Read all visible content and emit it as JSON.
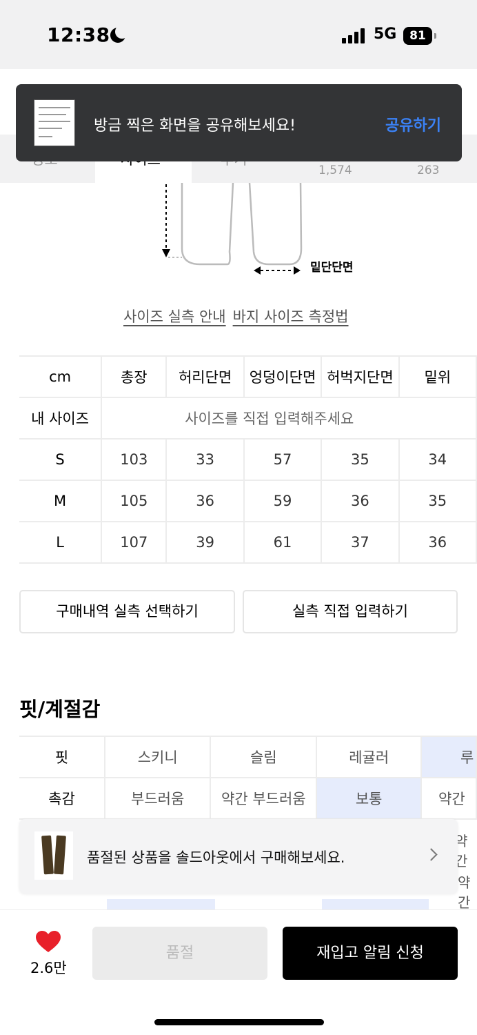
{
  "status_bar": {
    "time": "12:38",
    "network": "5G",
    "battery": "81"
  },
  "tabs": {
    "items": [
      "정보",
      "사이즈",
      "후기"
    ],
    "counts": [
      "1,574",
      "263"
    ]
  },
  "toast": {
    "message": "방금 찍은 화면을 공유해보세요!",
    "action": "공유하기"
  },
  "diagram": {
    "label": "밑단단면"
  },
  "size_links": [
    "사이즈 실측 안내",
    "바지 사이즈 측정법"
  ],
  "size_table": {
    "headers": [
      "cm",
      "총장",
      "허리단면",
      "엉덩이단면",
      "허벅지단면",
      "밑위"
    ],
    "my_size_label": "내 사이즈",
    "my_size_placeholder": "사이즈를 직접 입력해주세요",
    "rows": [
      {
        "size": "S",
        "values": [
          "103",
          "33",
          "57",
          "35",
          "34"
        ]
      },
      {
        "size": "M",
        "values": [
          "105",
          "36",
          "59",
          "36",
          "35"
        ]
      },
      {
        "size": "L",
        "values": [
          "107",
          "39",
          "61",
          "37",
          "36"
        ]
      }
    ]
  },
  "buttons": {
    "purchase_history": "구매내역 실측 선택하기",
    "manual_input": "실측 직접 입력하기"
  },
  "fit_section": {
    "title": "핏/계절감",
    "rows": [
      {
        "label": "핏",
        "options": [
          "스키니",
          "슬림",
          "레귤러",
          "루"
        ],
        "selected": 3
      },
      {
        "label": "촉감",
        "options": [
          "부드러움",
          "약간 부드러움",
          "보통",
          "약간"
        ],
        "selected": 2
      }
    ],
    "peek": [
      "약간",
      "약간"
    ]
  },
  "soldout_banner": {
    "text": "품절된 상품을 솔드아웃에서 구매해보세요."
  },
  "bottom_bar": {
    "likes": "2.6만",
    "soldout_label": "품절",
    "restock_label": "재입고 알림 신청"
  },
  "colors": {
    "accent_blue": "#3b82f6",
    "selected_cell": "#e6ecfc",
    "heart": "#e8202a"
  }
}
